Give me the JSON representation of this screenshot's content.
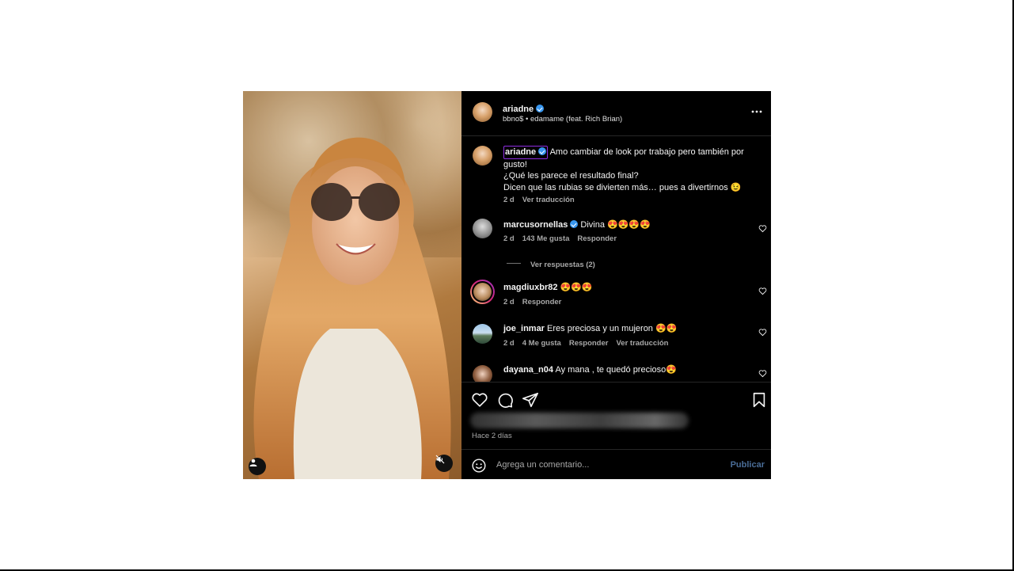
{
  "post": {
    "author": "ariadne",
    "audio": "bbno$ • edamame (feat. Rich Brian)",
    "caption_lines": [
      "Amo cambiar de look por trabajo pero también por",
      "gusto!",
      "¿Qué les parece el resultado final?",
      "Dicen que las rubias se divierten más… pues a divertirnos 😉"
    ],
    "caption_time": "2 d",
    "caption_translate": "Ver traducción"
  },
  "comments": [
    {
      "user": "marcusornellas",
      "verified": true,
      "text": "Divina 😍😍😍😍",
      "time": "2 d",
      "likes": "143 Me gusta",
      "reply": "Responder",
      "translate": ""
    },
    {
      "user": "magdiuxbr82",
      "verified": false,
      "text": "😍😍😍",
      "time": "2 d",
      "likes": "",
      "reply": "Responder",
      "translate": ""
    },
    {
      "user": "joe_inmar",
      "verified": false,
      "text": "Eres preciosa y un mujeron 😍😍",
      "time": "2 d",
      "likes": "4 Me gusta",
      "reply": "Responder",
      "translate": "Ver traducción"
    },
    {
      "user": "dayana_n04",
      "verified": false,
      "text": "Ay mana , te quedó precioso😍",
      "time": "",
      "likes": "",
      "reply": "",
      "translate": ""
    }
  ],
  "view_replies": "Ver respuestas (2)",
  "footer": {
    "time_ago": "Hace 2 días",
    "comment_placeholder": "Agrega un comentario...",
    "publish_label": "Publicar"
  },
  "icons": {
    "more": "more-options-icon",
    "like": "heart-icon",
    "comment": "comment-icon",
    "share": "share-icon",
    "save": "bookmark-icon",
    "emoji": "emoji-icon",
    "verified": "verified-badge-icon",
    "mute": "muted-speaker-icon",
    "profile": "user-profile-icon"
  },
  "colors": {
    "panel_background": "#000000",
    "verified_blue": "#3897f0",
    "publish_disabled": "#4a6d97",
    "muted_text": "#a8a8a8"
  }
}
